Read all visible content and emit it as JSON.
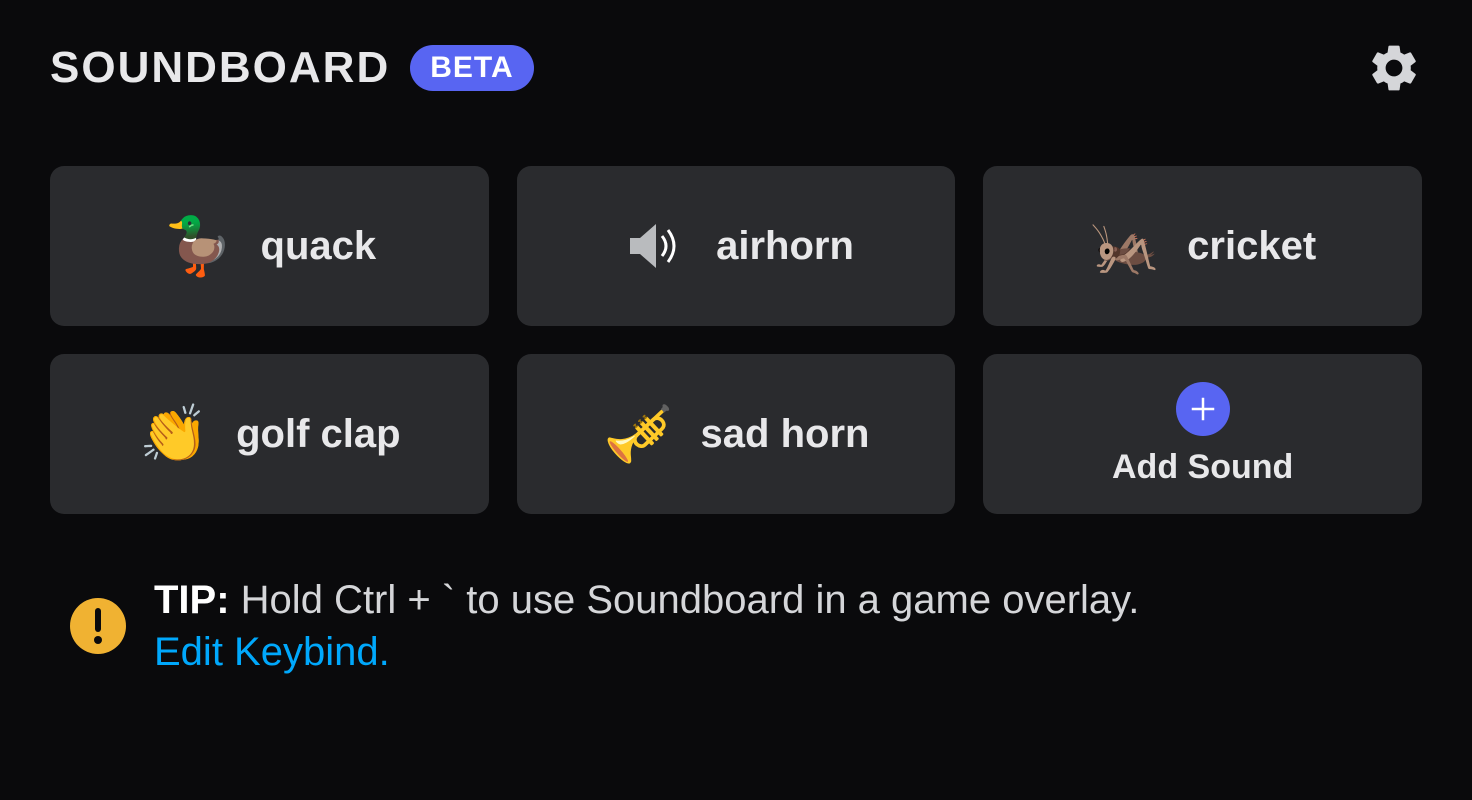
{
  "header": {
    "title": "SOUNDBOARD",
    "badge": "BETA"
  },
  "sounds": [
    {
      "label": "quack",
      "icon": "duck-icon"
    },
    {
      "label": "airhorn",
      "icon": "speaker-icon"
    },
    {
      "label": "cricket",
      "icon": "cricket-icon"
    },
    {
      "label": "golf clap",
      "icon": "clap-icon"
    },
    {
      "label": "sad horn",
      "icon": "trumpet-icon"
    }
  ],
  "add": {
    "label": "Add Sound"
  },
  "tip": {
    "prefix": "TIP:",
    "body": "Hold Ctrl + ` to use Soundboard in a game overlay.",
    "link": "Edit Keybind."
  },
  "colors": {
    "accent": "#5865f2",
    "warn": "#f0b232",
    "link": "#00a8fc"
  }
}
